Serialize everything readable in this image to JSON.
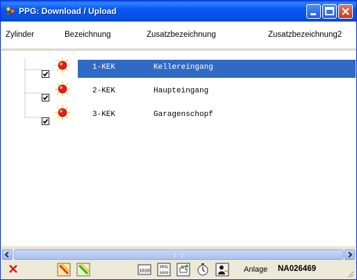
{
  "window": {
    "title": "PPG: Download / Upload",
    "colors": {
      "titlebar": "#0758f2",
      "selection": "#316ac5",
      "close": "#c7391b"
    }
  },
  "header": {
    "columns": [
      "Zylinder",
      "Bezeichnung",
      "Zusatzbezeichnung",
      "Zusatzbezeichnung2"
    ]
  },
  "tree": {
    "rows": [
      {
        "checked": true,
        "icon": "red-bulb-icon",
        "code": "1-KEK",
        "name": "Kellereingang",
        "selected": true
      },
      {
        "checked": true,
        "icon": "red-bulb-icon",
        "code": "2-KEK",
        "name": "Haupteingang",
        "selected": false
      },
      {
        "checked": true,
        "icon": "red-bulb-icon",
        "code": "3-KEK",
        "name": "Garagenschopf",
        "selected": false
      }
    ]
  },
  "toolbar": {
    "buttons": [
      "delete-icon",
      "download-icon",
      "upload-icon",
      "binary-icon",
      "ppg-binary-icon",
      "hand-key-icon",
      "timer-icon",
      "person-key-icon"
    ],
    "anlage_label": "Anlage",
    "anlage_value": "NA026469"
  }
}
